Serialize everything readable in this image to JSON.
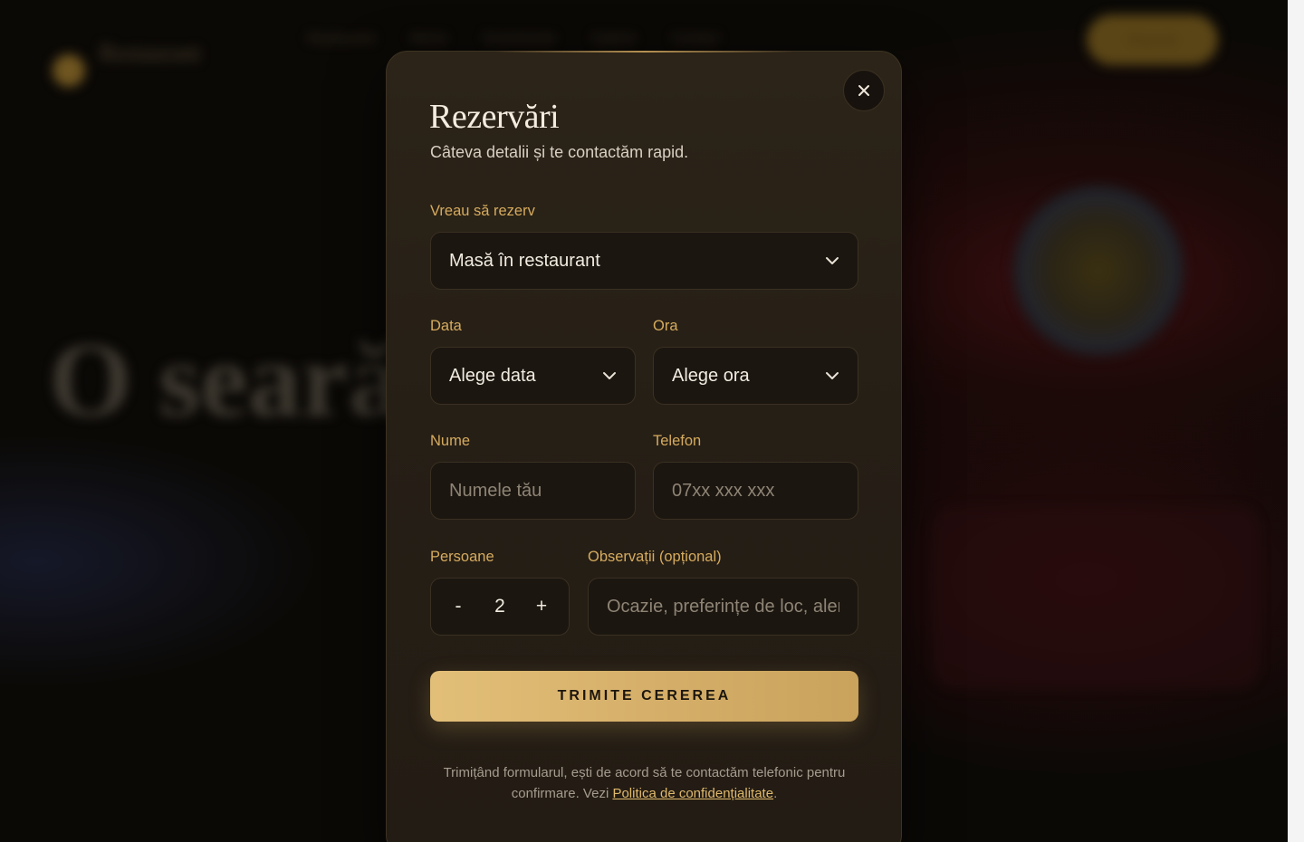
{
  "background": {
    "logo_text": "Restaurant",
    "nav": [
      "Restaurant",
      "Meniu",
      "Evenimente",
      "Galerie",
      "Contact"
    ],
    "cta": "Rezervă",
    "hero": "O seară"
  },
  "modal": {
    "title": "Rezervări",
    "subtitle": "Câteva detalii și te contactăm rapid.",
    "close_icon": "close-icon",
    "reserve_label": "Vreau să rezerv",
    "reserve_value": "Masă în restaurant",
    "date_label": "Data",
    "date_value": "Alege data",
    "time_label": "Ora",
    "time_value": "Alege ora",
    "name_label": "Nume",
    "name_placeholder": "Numele tău",
    "phone_label": "Telefon",
    "phone_placeholder": "07xx xxx xxx",
    "persons_label": "Persoane",
    "persons_minus": "-",
    "persons_value": "2",
    "persons_plus": "+",
    "notes_label": "Observații (opțional)",
    "notes_placeholder": "Ocazie, preferințe de loc, alergii...",
    "submit_label": "TRIMITE CEREREA",
    "legal_text": "Trimițând formularul, ești de acord să te contactăm telefonic pentru confirmare. Vezi ",
    "legal_link": "Politica de confidențialitate",
    "legal_end": "."
  },
  "colors": {
    "accent": "#d6ab5e",
    "button": "#dcb872",
    "modal_bg": "#261f16",
    "field_bg": "#1b1610"
  }
}
